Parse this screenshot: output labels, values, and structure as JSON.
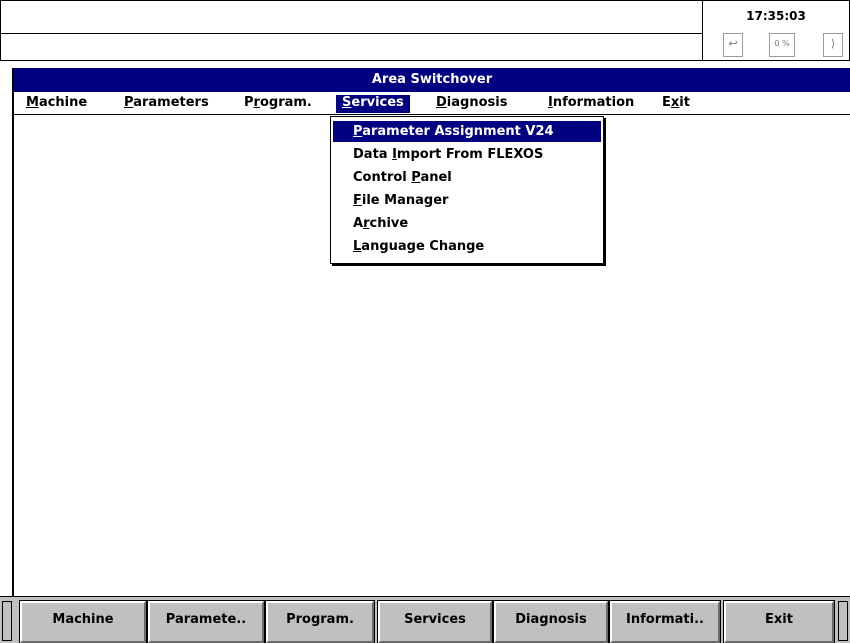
{
  "status": {
    "line1": "",
    "line2": "",
    "clock": "17:35:03",
    "indicators": [
      {
        "icon": "arrow-left-icon",
        "glyph": "↩"
      },
      {
        "icon": "percent-icon",
        "glyph": "0 %"
      },
      {
        "icon": "bracket-right-icon",
        "glyph": "⟩"
      }
    ]
  },
  "window": {
    "title": "Area Switchover"
  },
  "menu": {
    "items": [
      {
        "pre": "",
        "ul": "M",
        "post": "achine"
      },
      {
        "pre": "",
        "ul": "P",
        "post": "arameters"
      },
      {
        "pre": "P",
        "ul": "r",
        "post": "ogram."
      },
      {
        "pre": "",
        "ul": "S",
        "post": "ervices"
      },
      {
        "pre": "",
        "ul": "D",
        "post": "iagnosis"
      },
      {
        "pre": "",
        "ul": "I",
        "post": "nformation"
      },
      {
        "pre": "E",
        "ul": "x",
        "post": "it"
      }
    ],
    "active_index": 3
  },
  "dropdown": {
    "items": [
      {
        "pre": "",
        "ul": "P",
        "post": "arameter Assignment V24"
      },
      {
        "pre": "Data ",
        "ul": "I",
        "post": "mport From FLEXOS"
      },
      {
        "pre": "Control ",
        "ul": "P",
        "post": "anel"
      },
      {
        "pre": "",
        "ul": "F",
        "post": "ile Manager"
      },
      {
        "pre": "A",
        "ul": "r",
        "post": "chive"
      },
      {
        "pre": "",
        "ul": "L",
        "post": "anguage Change"
      }
    ],
    "selected_index": 0
  },
  "softkeys": [
    "Machine",
    "Paramete..",
    "Program.",
    "Services",
    "Diagnosis",
    "Informati..",
    "Exit"
  ]
}
